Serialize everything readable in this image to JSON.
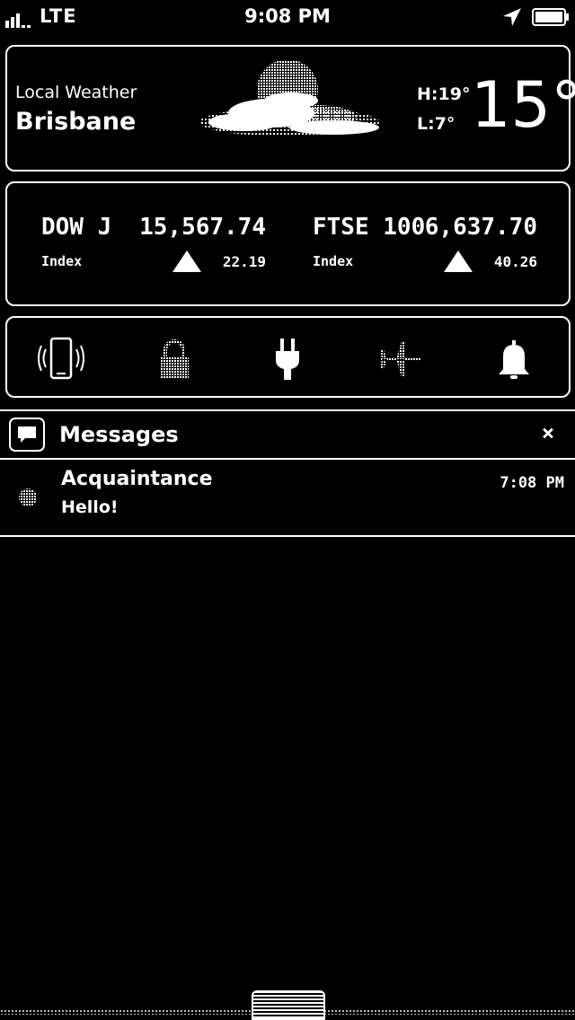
{
  "status_bar": {
    "carrier": "LTE",
    "time": "9:08 PM",
    "icons": [
      "signal-bars-icon",
      "location-arrow-icon",
      "battery-icon"
    ]
  },
  "weather": {
    "label": "Local Weather",
    "city": "Brisbane",
    "high": "H:19°",
    "low": "L:7°",
    "temperature": "15°",
    "icon": "partly-cloudy-icon"
  },
  "stocks": [
    {
      "name": "DOW J",
      "value": "15,567.74",
      "sub": "Index",
      "direction": "up",
      "change": "22.19"
    },
    {
      "name": "FTSE 100",
      "value": "6,637.70",
      "sub": "Index",
      "direction": "up",
      "change": "40.26"
    }
  ],
  "toggles": [
    {
      "name": "vibrate-icon"
    },
    {
      "name": "lock-icon"
    },
    {
      "name": "power-plug-icon"
    },
    {
      "name": "airplane-icon"
    },
    {
      "name": "bell-icon"
    }
  ],
  "notification": {
    "app": "Messages",
    "icon": "speech-bubble-icon",
    "close_icon": "close-icon",
    "close_glyph": "×",
    "items": [
      {
        "sender": "Acquaintance",
        "body": "Hello!",
        "time": "7:08 PM"
      }
    ]
  }
}
